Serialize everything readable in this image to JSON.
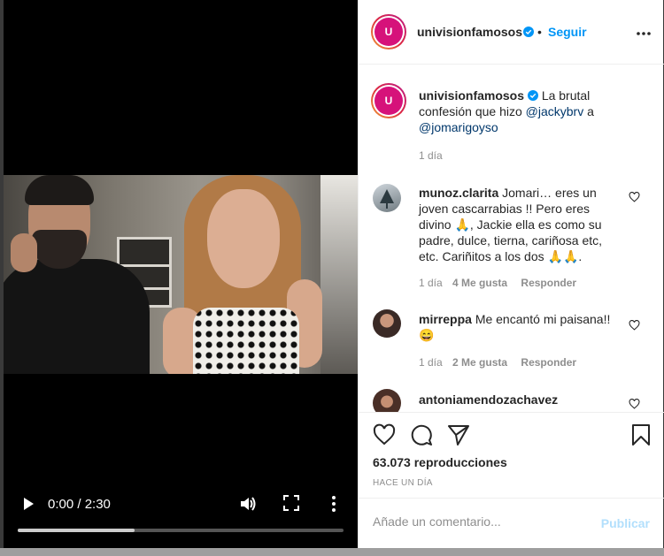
{
  "video": {
    "time": "0:00 / 2:30",
    "progress": 0.36,
    "icons": {
      "play": "play-icon",
      "volume": "volume-icon",
      "fullscreen": "fullscreen-icon",
      "more": "more-vertical-icon"
    }
  },
  "header": {
    "username": "univisionfamosos",
    "follow_label": "Seguir",
    "avatar_text": "U"
  },
  "caption": {
    "username": "univisionfamosos",
    "text_before": "La brutal confesión que hizo ",
    "mention1": "@jackybrv",
    "text_mid": " a ",
    "mention2": "@jomarigoyso",
    "time": "1 día"
  },
  "comments": [
    {
      "username": "munoz.clarita",
      "text": "Jomari… eres un joven cascarrabias !! Pero eres divino 🙏, Jackie ella es como su padre, dulce, tierna, cariñosa etc, etc. Cariñitos a los dos 🙏🙏.",
      "time": "1 día",
      "likes": "4 Me gusta",
      "reply": "Responder"
    },
    {
      "username": "mirreppa",
      "text": "Me encantó mi paisana!!😄",
      "time": "1 día",
      "likes": "2 Me gusta",
      "reply": "Responder"
    },
    {
      "username": "antoniamendozachavez",
      "text": "",
      "time": "",
      "likes": "",
      "reply": ""
    }
  ],
  "actions": {
    "views": "63.073 reproducciones",
    "ago": "HACE UN DÍA"
  },
  "composer": {
    "placeholder": "Añade un comentario...",
    "publish_label": "Publicar"
  },
  "colors": {
    "accent": "#0095f6",
    "brand": "#d6127a",
    "publish_disabled": "#b2dffc"
  }
}
